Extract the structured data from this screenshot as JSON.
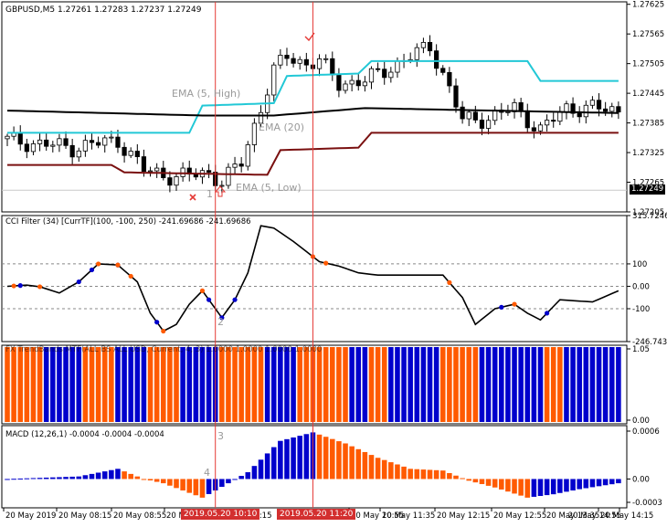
{
  "colors": {
    "background": "#ffffff",
    "frame": "#000000",
    "grid": "#c8c8c8",
    "bull_candle": "#ffffff",
    "bear_candle": "#000000",
    "ema_high": "#22c8d6",
    "ema_20": "#000000",
    "ema_low": "#7a1010",
    "vline": "#e53935",
    "orange": "#ff5a00",
    "blue": "#0000cc",
    "cci_line": "#000000",
    "level_line": "#888888",
    "annot": "#9a9a9a",
    "arrow_red": "#e53935"
  },
  "main_panel": {
    "header": "GBPUSD,M5  1.27261 1.27283 1.27237 1.27249",
    "y_ticks": [
      "1.27625",
      "1.27565",
      "1.27505",
      "1.27445",
      "1.27385",
      "1.27325",
      "1.27265",
      "1.27205"
    ],
    "current_price": "1.27249",
    "labels": {
      "ema_high": "EMA (5, High)",
      "ema_20": "EMA (20)",
      "ema_low": "EMA (5, Low)",
      "marker_1": "1"
    }
  },
  "cci_panel": {
    "header": "CCI Filter (34) [CurrTF](100, -100, 250) -241.69686 -241.69686",
    "y_ticks": [
      "315.7246",
      "100",
      "0.00",
      "-100",
      "-246.7434"
    ],
    "marker_2": "2"
  },
  "trend_panel": {
    "header": "FX TrendBands MTF(ALL BS ALL USD, Current, 4, 3) 1.0000 1.0000 1.0000 1.0000",
    "y_ticks": [
      "1.05",
      "0.00"
    ]
  },
  "macd_panel": {
    "header": "MACD (12,26,1) -0.0004 -0.0004 -0.0004",
    "y_ticks": [
      "0.0006",
      "0.00",
      "-0.0003"
    ],
    "marker_3": "3",
    "marker_4": "4"
  },
  "time_axis": {
    "labels": [
      "20 May 2019",
      "20 May 08:15",
      "20 May 08:55",
      "20 May 09:35",
      "20 May 10:55",
      "20 May 11:35",
      "20 May 12:15",
      "20 May 12:55",
      "20 May 13:35",
      "20 May 14:15",
      "20 May 14:55"
    ],
    "highlight_1": "2019.05.20 10:10",
    "highlight_2": "2019.05.20 11:20",
    "partial_label": "10:15"
  },
  "chart_data": {
    "type": "candlestick",
    "bars": 95,
    "price_range": [
      1.27205,
      1.2763
    ],
    "close_anchors": [
      [
        0,
        1.2735
      ],
      [
        10,
        1.27335
      ],
      [
        17,
        1.2735
      ],
      [
        21,
        1.2729
      ],
      [
        26,
        1.27275
      ],
      [
        31,
        1.27285
      ],
      [
        33,
        1.27265
      ],
      [
        36,
        1.27305
      ],
      [
        38,
        1.2738
      ],
      [
        41,
        1.2749
      ],
      [
        43,
        1.2752
      ],
      [
        46,
        1.27505
      ],
      [
        48,
        1.2751
      ],
      [
        51,
        1.27465
      ],
      [
        55,
        1.2747
      ],
      [
        60,
        1.27505
      ],
      [
        65,
        1.2754
      ],
      [
        67,
        1.27485
      ],
      [
        70,
        1.2739
      ],
      [
        74,
        1.27395
      ],
      [
        78,
        1.27415
      ],
      [
        82,
        1.2737
      ],
      [
        86,
        1.27415
      ],
      [
        90,
        1.27415
      ],
      [
        94,
        1.2741
      ]
    ],
    "ema_high_anchors": [
      [
        0,
        1.27365
      ],
      [
        28,
        1.27365
      ],
      [
        30,
        1.2742
      ],
      [
        41,
        1.27425
      ],
      [
        43,
        1.2748
      ],
      [
        54,
        1.27485
      ],
      [
        56,
        1.2751
      ],
      [
        80,
        1.2751
      ],
      [
        82,
        1.2747
      ],
      [
        94,
        1.2747
      ]
    ],
    "ema20_anchors": [
      [
        0,
        1.2741
      ],
      [
        30,
        1.274
      ],
      [
        41,
        1.274
      ],
      [
        55,
        1.27415
      ],
      [
        94,
        1.27405
      ]
    ],
    "ema_low_anchors": [
      [
        0,
        1.273
      ],
      [
        16,
        1.273
      ],
      [
        18,
        1.27285
      ],
      [
        40,
        1.2728
      ],
      [
        42,
        1.2733
      ],
      [
        54,
        1.27335
      ],
      [
        56,
        1.27365
      ],
      [
        94,
        1.27365
      ]
    ],
    "cci_anchors": [
      [
        0,
        0
      ],
      [
        3,
        5
      ],
      [
        5,
        -2
      ],
      [
        8,
        -30
      ],
      [
        11,
        20
      ],
      [
        14,
        100
      ],
      [
        17,
        95
      ],
      [
        20,
        20
      ],
      [
        22,
        -120
      ],
      [
        24,
        -200
      ],
      [
        26,
        -170
      ],
      [
        28,
        -80
      ],
      [
        30,
        -20
      ],
      [
        32,
        -100
      ],
      [
        33,
        -140
      ],
      [
        35,
        -60
      ],
      [
        37,
        60
      ],
      [
        39,
        270
      ],
      [
        41,
        260
      ],
      [
        44,
        200
      ],
      [
        48,
        110
      ],
      [
        51,
        90
      ],
      [
        54,
        60
      ],
      [
        57,
        50
      ],
      [
        61,
        50
      ],
      [
        67,
        50
      ],
      [
        70,
        -50
      ],
      [
        72,
        -170
      ],
      [
        75,
        -100
      ],
      [
        78,
        -80
      ],
      [
        80,
        -120
      ],
      [
        82,
        -150
      ],
      [
        85,
        -60
      ],
      [
        90,
        -70
      ],
      [
        94,
        -20
      ]
    ],
    "cci_range": [
      -246.7434,
      315.7246
    ],
    "macd_anchors": [
      [
        0,
        0.0
      ],
      [
        11,
        3e-05
      ],
      [
        17,
        0.00012
      ],
      [
        21,
        0.0
      ],
      [
        24,
        -5e-05
      ],
      [
        30,
        -0.00022
      ],
      [
        34,
        -5e-05
      ],
      [
        37,
        8e-05
      ],
      [
        42,
        0.00045
      ],
      [
        47,
        0.00055
      ],
      [
        52,
        0.00042
      ],
      [
        57,
        0.00025
      ],
      [
        62,
        0.00012
      ],
      [
        67,
        0.0001
      ],
      [
        71,
        -2e-05
      ],
      [
        75,
        -0.0001
      ],
      [
        80,
        -0.00022
      ],
      [
        84,
        -0.00018
      ],
      [
        88,
        -0.00012
      ],
      [
        94,
        -5e-05
      ]
    ],
    "macd_range": [
      -0.00034,
      0.00063
    ],
    "trend_blue_ranges": [
      [
        6,
        11
      ],
      [
        17,
        21
      ],
      [
        27,
        29
      ],
      [
        30,
        32
      ],
      [
        40,
        44
      ],
      [
        53,
        55
      ],
      [
        59,
        66
      ],
      [
        73,
        82
      ],
      [
        86,
        94
      ]
    ],
    "cci_dots": [
      [
        1,
        "orange"
      ],
      [
        2,
        "blue"
      ],
      [
        5,
        "orange"
      ],
      [
        11,
        "blue"
      ],
      [
        13,
        "blue"
      ],
      [
        14,
        "orange"
      ],
      [
        17,
        "blue"
      ],
      [
        17,
        "orange"
      ],
      [
        19,
        "orange"
      ],
      [
        23,
        "blue"
      ],
      [
        24,
        "orange"
      ],
      [
        30,
        "orange"
      ],
      [
        31,
        "blue"
      ],
      [
        33,
        "blue"
      ],
      [
        35,
        "blue"
      ],
      [
        47,
        "orange"
      ],
      [
        49,
        "orange"
      ],
      [
        68,
        "orange"
      ],
      [
        76,
        "blue"
      ],
      [
        78,
        "orange"
      ],
      [
        83,
        "blue"
      ]
    ],
    "vlines_at_bar": [
      32,
      47
    ]
  }
}
